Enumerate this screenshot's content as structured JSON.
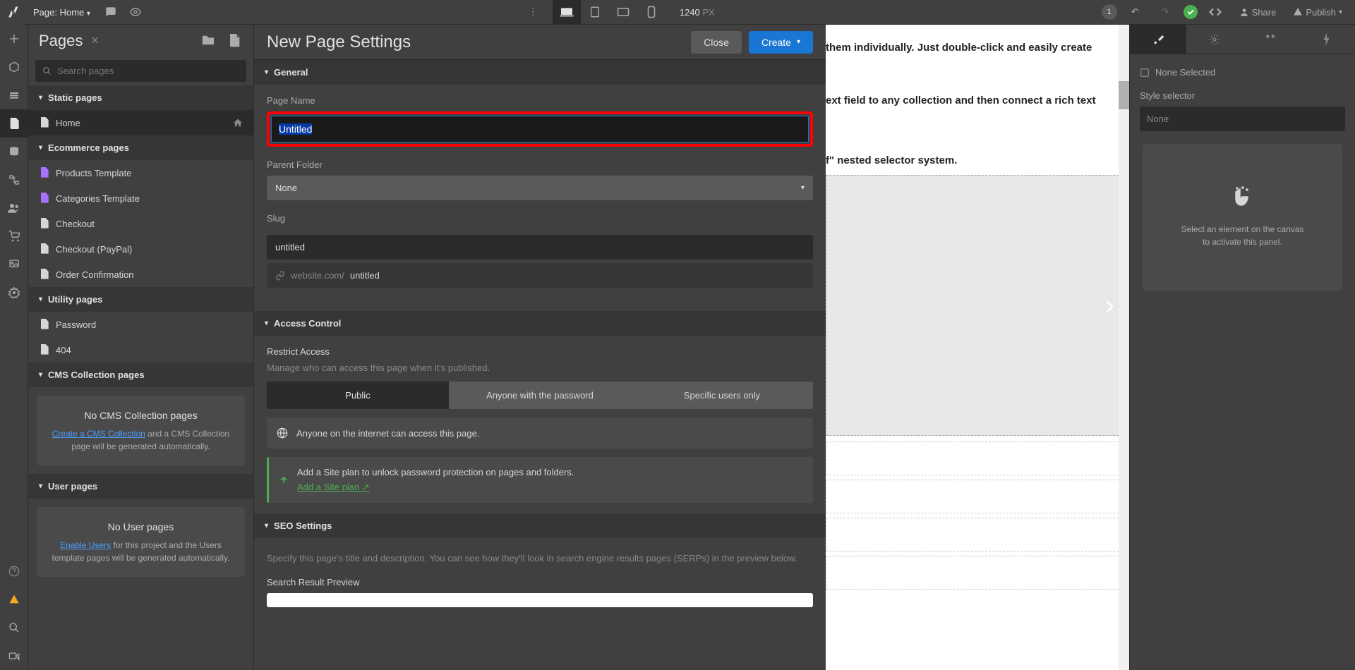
{
  "topbar": {
    "page_prefix": "Page:",
    "page_name": "Home",
    "width_value": "1240",
    "width_unit": "PX",
    "badge": "1",
    "share": "Share",
    "publish": "Publish"
  },
  "pages": {
    "title": "Pages",
    "search_placeholder": "Search pages",
    "static_header": "Static pages",
    "home": "Home",
    "ecom_header": "Ecommerce pages",
    "ecom_items": [
      "Products Template",
      "Categories Template",
      "Checkout",
      "Checkout (PayPal)",
      "Order Confirmation"
    ],
    "utility_header": "Utility pages",
    "utility_items": [
      "Password",
      "404"
    ],
    "cms_header": "CMS Collection pages",
    "cms_empty_title": "No CMS Collection pages",
    "cms_empty_link": "Create a CMS Collection",
    "cms_empty_text": " and a CMS Collection page will be generated automatically.",
    "user_header": "User pages",
    "user_empty_title": "No User pages",
    "user_empty_link": "Enable Users",
    "user_empty_text": " for this project and the Users template pages will be generated automatically."
  },
  "settings": {
    "title": "New Page Settings",
    "close": "Close",
    "create": "Create",
    "general": "General",
    "page_name_label": "Page Name",
    "page_name_value": "Untitled",
    "parent_folder_label": "Parent Folder",
    "parent_folder_value": "None",
    "slug_label": "Slug",
    "slug_value": "untitled",
    "url_prefix": "website.com/",
    "url_slug": "untitled",
    "access_header": "Access Control",
    "restrict_label": "Restrict Access",
    "restrict_sub": "Manage who can access this page when it's published.",
    "seg_public": "Public",
    "seg_password": "Anyone with the password",
    "seg_specific": "Specific users only",
    "public_info": "Anyone on the internet can access this page.",
    "plan_info": "Add a Site plan to unlock password protection on pages and folders.",
    "plan_link": "Add a Site plan",
    "seo_header": "SEO Settings",
    "seo_desc": "Specify this page's title and description. You can see how they'll look in search engine results pages (SERPs) in the preview below.",
    "seo_preview_label": "Search Result Preview"
  },
  "canvas": {
    "line1": "them individually. Just double-click and easily create",
    "line2": "ext field to any collection and then connect a rich text",
    "line3": "f\" nested selector system."
  },
  "right": {
    "none_selected": "None Selected",
    "style_selector": "Style selector",
    "style_value": "None",
    "empty_text1": "Select an element on the canvas",
    "empty_text2": "to activate this panel."
  }
}
